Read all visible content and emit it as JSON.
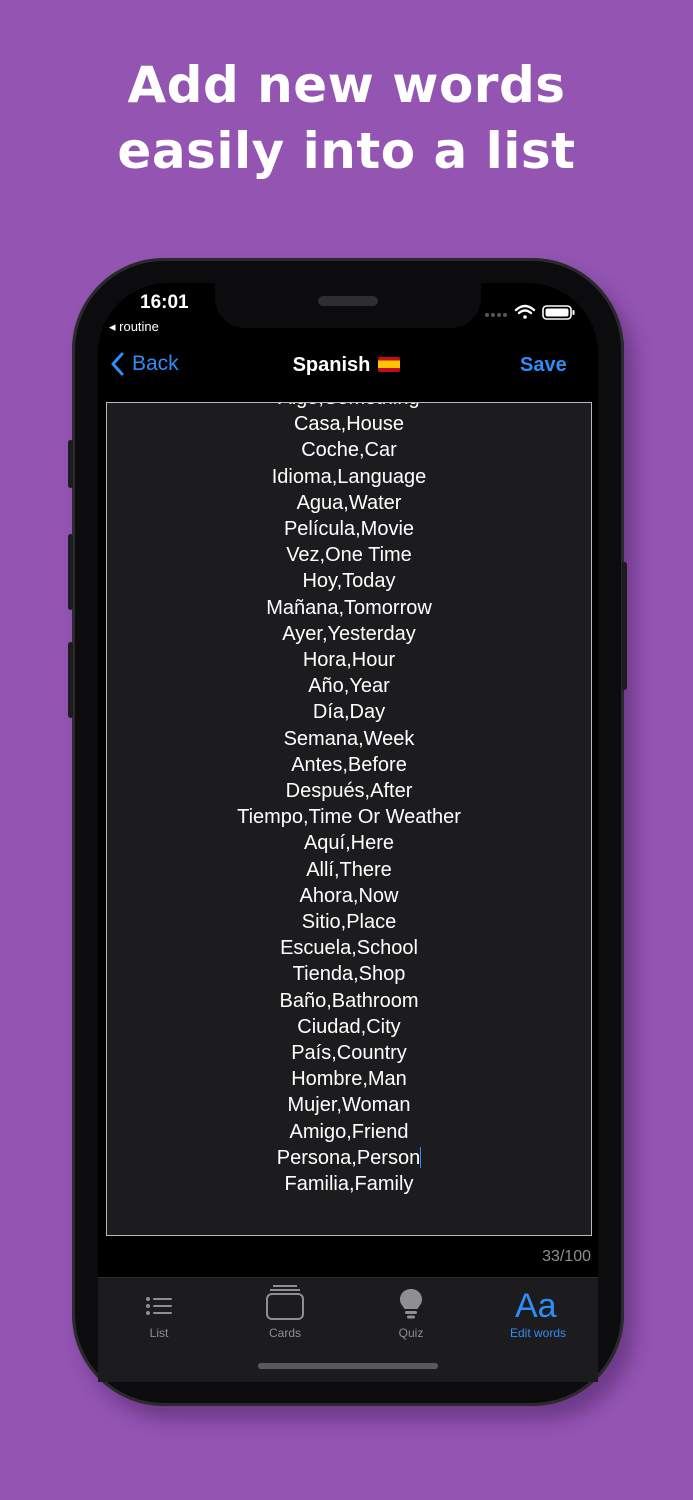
{
  "headline": {
    "line1": "Add new words",
    "line2": "easily into a list"
  },
  "status_bar": {
    "time": "16:01",
    "back_app": "◂ routine"
  },
  "nav": {
    "back_label": "Back",
    "title": "Spanish",
    "flag_icon": "spain-flag-icon",
    "save_label": "Save"
  },
  "editor": {
    "partial_top_line": "Algo,Something",
    "words": [
      "Casa,House",
      "Coche,Car",
      "Idioma,Language",
      "Agua,Water",
      "Película,Movie",
      "Vez,One Time",
      "Hoy,Today",
      "Mañana,Tomorrow",
      "Ayer,Yesterday",
      "Hora,Hour",
      "Año,Year",
      "Día,Day",
      "Semana,Week",
      "Antes,Before",
      "Después,After",
      "Tiempo,Time Or Weather",
      "Aquí,Here",
      "Allí,There",
      "Ahora,Now",
      "Sitio,Place",
      "Escuela,School",
      "Tienda,Shop",
      "Baño,Bathroom",
      "Ciudad,City",
      "País,Country",
      "Hombre,Man",
      "Mujer,Woman",
      "Amigo,Friend",
      "Persona,Person",
      "Familia,Family"
    ],
    "counter": "33/100"
  },
  "tabs": [
    {
      "label": "List",
      "icon": "list-icon",
      "active": false
    },
    {
      "label": "Cards",
      "icon": "cards-icon",
      "active": false
    },
    {
      "label": "Quiz",
      "icon": "lightbulb-icon",
      "active": false
    },
    {
      "label": "Edit words",
      "icon": "text-size-icon",
      "active": true
    }
  ],
  "colors": {
    "background": "#9354b2",
    "accent": "#2f8df7",
    "screen_bg": "#000000",
    "editor_bg": "#1c1c1e"
  }
}
